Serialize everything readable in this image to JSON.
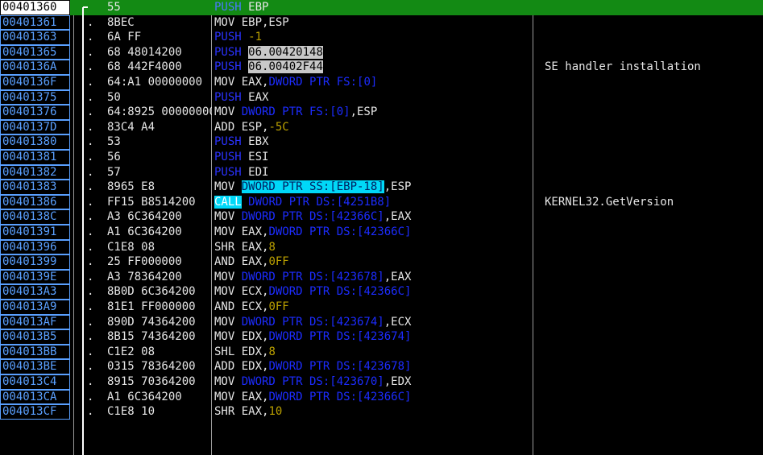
{
  "rows": [
    {
      "addr": "00401360",
      "dot": "",
      "hex": "55",
      "segs": [
        {
          "t": "PUSH",
          "c": "kw"
        },
        {
          "t": " EBP",
          "c": "mn"
        }
      ],
      "cmt": "",
      "sel": true
    },
    {
      "addr": "00401361",
      "dot": ".",
      "hex": "8BEC",
      "segs": [
        {
          "t": "MOV EBP,ESP",
          "c": "mn"
        }
      ],
      "cmt": ""
    },
    {
      "addr": "00401363",
      "dot": ".",
      "hex": "6A FF",
      "segs": [
        {
          "t": "PUSH",
          "c": "kw"
        },
        {
          "t": " ",
          "c": "mn"
        },
        {
          "t": "-1",
          "c": "num"
        }
      ],
      "cmt": ""
    },
    {
      "addr": "00401365",
      "dot": ".",
      "hex": "68 48014200",
      "segs": [
        {
          "t": "PUSH",
          "c": "kw"
        },
        {
          "t": " ",
          "c": "mn"
        },
        {
          "t": "06.00420148",
          "c": "imm"
        }
      ],
      "cmt": ""
    },
    {
      "addr": "0040136A",
      "dot": ".",
      "hex": "68 442F4000",
      "segs": [
        {
          "t": "PUSH",
          "c": "kw"
        },
        {
          "t": " ",
          "c": "mn"
        },
        {
          "t": "06.00402F44",
          "c": "imm"
        }
      ],
      "cmt": "SE handler installation"
    },
    {
      "addr": "0040136F",
      "dot": ".",
      "hex": "64:A1 00000000",
      "segs": [
        {
          "t": "MOV EAX,",
          "c": "mn"
        },
        {
          "t": "DWORD PTR FS:[0]",
          "c": "ptr"
        }
      ],
      "cmt": ""
    },
    {
      "addr": "00401375",
      "dot": ".",
      "hex": "50",
      "segs": [
        {
          "t": "PUSH",
          "c": "kw"
        },
        {
          "t": " EAX",
          "c": "mn"
        }
      ],
      "cmt": ""
    },
    {
      "addr": "00401376",
      "dot": ".",
      "hex": "64:8925 00000000",
      "segs": [
        {
          "t": "MOV ",
          "c": "mn"
        },
        {
          "t": "DWORD PTR FS:[0]",
          "c": "ptr"
        },
        {
          "t": ",ESP",
          "c": "mn"
        }
      ],
      "cmt": ""
    },
    {
      "addr": "0040137D",
      "dot": ".",
      "hex": "83C4 A4",
      "segs": [
        {
          "t": "ADD ESP,",
          "c": "mn"
        },
        {
          "t": "-5C",
          "c": "num"
        }
      ],
      "cmt": ""
    },
    {
      "addr": "00401380",
      "dot": ".",
      "hex": "53",
      "segs": [
        {
          "t": "PUSH",
          "c": "kw"
        },
        {
          "t": " EBX",
          "c": "mn"
        }
      ],
      "cmt": ""
    },
    {
      "addr": "00401381",
      "dot": ".",
      "hex": "56",
      "segs": [
        {
          "t": "PUSH",
          "c": "kw"
        },
        {
          "t": " ESI",
          "c": "mn"
        }
      ],
      "cmt": ""
    },
    {
      "addr": "00401382",
      "dot": ".",
      "hex": "57",
      "segs": [
        {
          "t": "PUSH",
          "c": "kw"
        },
        {
          "t": " EDI",
          "c": "mn"
        }
      ],
      "cmt": ""
    },
    {
      "addr": "00401383",
      "dot": ".",
      "hex": "8965 E8",
      "segs": [
        {
          "t": "MOV ",
          "c": "mn"
        },
        {
          "t": "DWORD PTR SS:[EBP-18]",
          "c": "hl"
        },
        {
          "t": ",ESP",
          "c": "mn"
        }
      ],
      "cmt": ""
    },
    {
      "addr": "00401386",
      "dot": ".",
      "hex": "FF15 B8514200",
      "segs": [
        {
          "t": "CALL",
          "c": "hlw"
        },
        {
          "t": " ",
          "c": "mn"
        },
        {
          "t": "DWORD PTR DS:[4251B8]",
          "c": "ptr"
        }
      ],
      "cmt": "KERNEL32.GetVersion"
    },
    {
      "addr": "0040138C",
      "dot": ".",
      "hex": "A3 6C364200",
      "segs": [
        {
          "t": "MOV ",
          "c": "mn"
        },
        {
          "t": "DWORD PTR DS:[42366C]",
          "c": "ptr"
        },
        {
          "t": ",EAX",
          "c": "mn"
        }
      ],
      "cmt": ""
    },
    {
      "addr": "00401391",
      "dot": ".",
      "hex": "A1 6C364200",
      "segs": [
        {
          "t": "MOV EAX,",
          "c": "mn"
        },
        {
          "t": "DWORD PTR DS:[42366C]",
          "c": "ptr"
        }
      ],
      "cmt": ""
    },
    {
      "addr": "00401396",
      "dot": ".",
      "hex": "C1E8 08",
      "segs": [
        {
          "t": "SHR EAX,",
          "c": "mn"
        },
        {
          "t": "8",
          "c": "num"
        }
      ],
      "cmt": ""
    },
    {
      "addr": "00401399",
      "dot": ".",
      "hex": "25 FF000000",
      "segs": [
        {
          "t": "AND EAX,",
          "c": "mn"
        },
        {
          "t": "0FF",
          "c": "num"
        }
      ],
      "cmt": ""
    },
    {
      "addr": "0040139E",
      "dot": ".",
      "hex": "A3 78364200",
      "segs": [
        {
          "t": "MOV ",
          "c": "mn"
        },
        {
          "t": "DWORD PTR DS:[423678]",
          "c": "ptr"
        },
        {
          "t": ",EAX",
          "c": "mn"
        }
      ],
      "cmt": ""
    },
    {
      "addr": "004013A3",
      "dot": ".",
      "hex": "8B0D 6C364200",
      "segs": [
        {
          "t": "MOV ECX,",
          "c": "mn"
        },
        {
          "t": "DWORD PTR DS:[42366C]",
          "c": "ptr"
        }
      ],
      "cmt": ""
    },
    {
      "addr": "004013A9",
      "dot": ".",
      "hex": "81E1 FF000000",
      "segs": [
        {
          "t": "AND ECX,",
          "c": "mn"
        },
        {
          "t": "0FF",
          "c": "num"
        }
      ],
      "cmt": ""
    },
    {
      "addr": "004013AF",
      "dot": ".",
      "hex": "890D 74364200",
      "segs": [
        {
          "t": "MOV ",
          "c": "mn"
        },
        {
          "t": "DWORD PTR DS:[423674]",
          "c": "ptr"
        },
        {
          "t": ",ECX",
          "c": "mn"
        }
      ],
      "cmt": ""
    },
    {
      "addr": "004013B5",
      "dot": ".",
      "hex": "8B15 74364200",
      "segs": [
        {
          "t": "MOV EDX,",
          "c": "mn"
        },
        {
          "t": "DWORD PTR DS:[423674]",
          "c": "ptr"
        }
      ],
      "cmt": ""
    },
    {
      "addr": "004013BB",
      "dot": ".",
      "hex": "C1E2 08",
      "segs": [
        {
          "t": "SHL EDX,",
          "c": "mn"
        },
        {
          "t": "8",
          "c": "num"
        }
      ],
      "cmt": ""
    },
    {
      "addr": "004013BE",
      "dot": ".",
      "hex": "0315 78364200",
      "segs": [
        {
          "t": "ADD EDX,",
          "c": "mn"
        },
        {
          "t": "DWORD PTR DS:[423678]",
          "c": "ptr"
        }
      ],
      "cmt": ""
    },
    {
      "addr": "004013C4",
      "dot": ".",
      "hex": "8915 70364200",
      "segs": [
        {
          "t": "MOV ",
          "c": "mn"
        },
        {
          "t": "DWORD PTR DS:[423670]",
          "c": "ptr"
        },
        {
          "t": ",EDX",
          "c": "mn"
        }
      ],
      "cmt": ""
    },
    {
      "addr": "004013CA",
      "dot": ".",
      "hex": "A1 6C364200",
      "segs": [
        {
          "t": "MOV EAX,",
          "c": "mn"
        },
        {
          "t": "DWORD PTR DS:[42366C]",
          "c": "ptr"
        }
      ],
      "cmt": ""
    },
    {
      "addr": "004013CF",
      "dot": ".",
      "hex": "C1E8 10",
      "segs": [
        {
          "t": "SHR EAX,",
          "c": "mn"
        },
        {
          "t": "10",
          "c": "num"
        }
      ],
      "cmt": ""
    }
  ]
}
